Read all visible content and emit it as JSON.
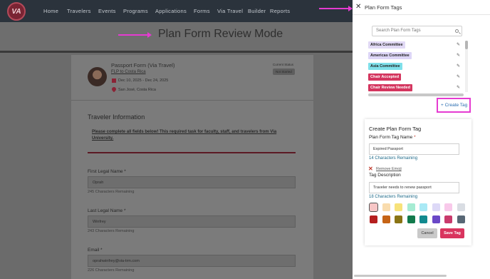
{
  "nav": {
    "logo": "VA",
    "items": [
      "Home",
      "Travelers",
      "Events",
      "Programs",
      "Applications",
      "Forms",
      "Via Travel",
      "Builder",
      "Reports"
    ]
  },
  "page": {
    "title": "Plan Form Review Mode"
  },
  "passport": {
    "title": "Passport Form (Via Travel)",
    "plan_link": "FLP to Costa Rica",
    "dates": "Dec 10, 2025 - Dec 24, 2025",
    "location": "San José, Costa Rica",
    "status_label": "Current Status",
    "status_value": "Not Started"
  },
  "traveler": {
    "section_title": "Traveler Information",
    "notice": "Please complete all fields below! This required task for faculty, staff, and travelers from Via University.",
    "fields": [
      {
        "label": "First Legal Name *",
        "value": "Oprah",
        "hint": "245 Characters Remaining"
      },
      {
        "label": "Last Legal Name *",
        "value": "Winfrey",
        "hint": "243 Characters Remaining"
      },
      {
        "label": "Email *",
        "value": "oprahwinfrey@via-trm.com",
        "hint": "226 Characters Remaining"
      }
    ]
  },
  "panel": {
    "title": "Plan Form Tags",
    "search_placeholder": "Search Plan Form Tags",
    "tags": [
      {
        "label": "Africa Committee",
        "bg": "#e1d9f5",
        "fg": "#222"
      },
      {
        "label": "Americas Committee",
        "bg": "#ddd6f7",
        "fg": "#222"
      },
      {
        "label": "Asia Committee",
        "bg": "#7fe0ea",
        "fg": "#222"
      },
      {
        "label": "Chair Accepted",
        "bg": "#d4365f",
        "fg": "#fff"
      },
      {
        "label": "Chair Review Needed",
        "bg": "#d4365f",
        "fg": "#fff"
      }
    ],
    "create_link": "+ Create Tag",
    "create_card": {
      "title": "Create Plan Form Tag",
      "name_label": "Plan Form Tag Name",
      "name_value": "Expired Passport",
      "name_hint": "14 Characters Remaining",
      "remove_emoji": "Remove Emoji",
      "desc_label": "Tag Description",
      "desc_value": "Traveler needs to renew passport",
      "desc_hint": "18 Characters Remaining",
      "colors_row1": [
        "#f7c6c6",
        "#f9dcae",
        "#f7e27a",
        "#a6ecd3",
        "#a9e9f5",
        "#ddd9f7",
        "#f8c9ea",
        "#d9dde3"
      ],
      "colors_row2": [
        "#b51f1f",
        "#c66416",
        "#8a7414",
        "#127a4c",
        "#118a8f",
        "#6a48c7",
        "#c93a6c",
        "#586775"
      ],
      "cancel_label": "Cancel",
      "save_label": "Save Tag"
    }
  }
}
